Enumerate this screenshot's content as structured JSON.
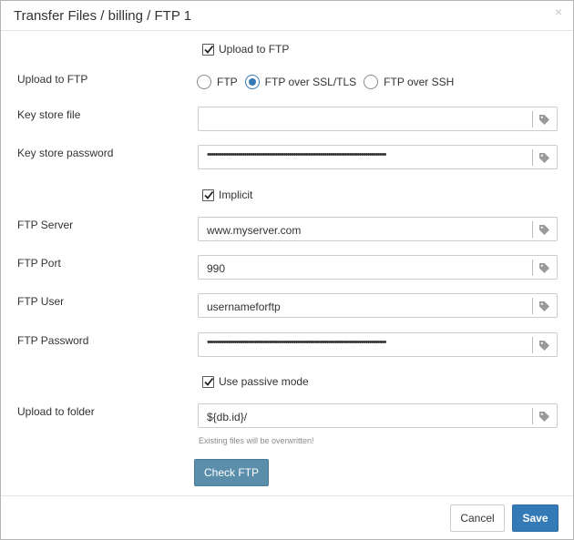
{
  "dialog": {
    "title": "Transfer Files / billing / FTP 1",
    "close_glyph": "×"
  },
  "form": {
    "upload_checkbox": {
      "label": "Upload to FTP",
      "checked": true
    },
    "protocol": {
      "label": "Upload to FTP",
      "options": [
        {
          "label": "FTP",
          "checked": false
        },
        {
          "label": "FTP over SSL/TLS",
          "checked": true
        },
        {
          "label": "FTP over SSH",
          "checked": false
        }
      ]
    },
    "key_store_file": {
      "label": "Key store file",
      "value": "",
      "icon": "tag-icon"
    },
    "key_store_password": {
      "label": "Key store password",
      "masked_value": "•••••••••••••••••••••••••••••••••••••••••••••••••••••••••••••••••••••••••••••••••••••••",
      "icon": "tag-icon"
    },
    "implicit": {
      "label": "Implicit",
      "checked": true
    },
    "ftp_server": {
      "label": "FTP Server",
      "value": "www.myserver.com",
      "icon": "tag-icon"
    },
    "ftp_port": {
      "label": "FTP Port",
      "value": "990",
      "icon": "tag-icon"
    },
    "ftp_user": {
      "label": "FTP User",
      "value": "usernameforftp",
      "icon": "tag-icon"
    },
    "ftp_password": {
      "label": "FTP Password",
      "masked_value": "•••••••••••••••••••••••••••••••••••••••••••••••••••••••••••••••••••••••••••••••••••••••",
      "icon": "tag-icon"
    },
    "passive_mode": {
      "label": "Use passive mode",
      "checked": true
    },
    "upload_folder": {
      "label": "Upload to folder",
      "value": "${db.id}/",
      "icon": "tag-icon",
      "hint": "Existing files will be overwritten!"
    },
    "check_button": "Check FTP"
  },
  "footer": {
    "cancel_label": "Cancel",
    "save_label": "Save"
  },
  "colors": {
    "primary": "#337ab7",
    "check_button": "#5b8eab",
    "border": "#cccccc"
  }
}
